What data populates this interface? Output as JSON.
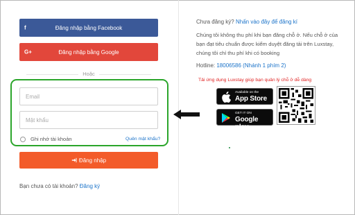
{
  "social": {
    "facebook_icon": "f",
    "facebook_label": "Đăng nhập bằng Facebook",
    "google_icon": "G+",
    "google_label": "Đăng nhập bằng Google"
  },
  "separator": "Hoặc",
  "form": {
    "email_placeholder": "Email",
    "password_placeholder": "Mật khẩu",
    "remember_label": "Ghi nhớ tài khoản",
    "forgot_link": "Quên mật khẩu?",
    "login_label": "Đăng nhập"
  },
  "signup": {
    "prompt": "Bạn chưa có tài khoản?",
    "link": "Đăng ký"
  },
  "host": {
    "question": "Chưa đăng ký?",
    "register_link": "Nhấn vào đây để đăng kí",
    "description": "Chúng tôi không thu phí khi bạn đăng chỗ ở. Nếu chỗ ở của bạn đạt tiêu chuẩn được kiểm duyệt đăng tải trên Luxstay, chúng tôi chỉ thu phí khi có booking",
    "hotline_label": "Hotline:",
    "hotline_value": "18006586 (Nhánh 1 phím 2)"
  },
  "app": {
    "note": "Tải ứng dụng Luxstay giúp bạn quản lý chỗ ở dễ dàng",
    "appstore_small": "Available on the",
    "appstore_big": "App Store",
    "googleplay_small": "GET IT ON",
    "googleplay_big": "Google play"
  },
  "colors": {
    "facebook": "#3b5998",
    "google": "#e2473b",
    "login": "#f35b2a",
    "link": "#1b73c9",
    "highlight_border": "#2aa52a",
    "app_note": "#e02020"
  }
}
